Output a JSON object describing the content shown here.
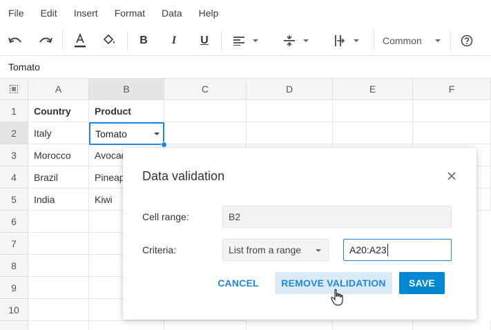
{
  "menu": [
    "File",
    "Edit",
    "Insert",
    "Format",
    "Data",
    "Help"
  ],
  "toolbar": {
    "undo_icon": "undo-icon",
    "redo_icon": "redo-icon",
    "text_color_icon": "text-color-icon",
    "fill_color_icon": "fill-color-icon",
    "bold_icon": "bold-icon",
    "italic_icon": "italic-icon",
    "underline_icon": "underline-icon",
    "align_icon": "align-left-icon",
    "valign_icon": "vertical-align-icon",
    "wrap_icon": "text-wrap-icon",
    "number_format": "Common",
    "help_icon": "help-icon"
  },
  "formula_bar": {
    "value": "Tomato"
  },
  "columns": [
    "A",
    "B",
    "C",
    "D",
    "E",
    "F"
  ],
  "rows": [
    "1",
    "2",
    "3",
    "4",
    "5",
    "6",
    "7",
    "8",
    "9",
    "10"
  ],
  "cells": {
    "A1": "Country",
    "B1": "Product",
    "A2": "Italy",
    "B2": "Tomato",
    "A3": "Morocco",
    "B3": "Avocado",
    "A4": "Brazil",
    "B4": "Pineapple",
    "A5": "India",
    "B5": "Kiwi"
  },
  "dialog": {
    "title": "Data validation",
    "cell_range_label": "Cell range:",
    "cell_range_value": "B2",
    "criteria_label": "Criteria:",
    "criteria_value": "List from a range",
    "range_value": "A20:A23",
    "cancel": "CANCEL",
    "remove": "REMOVE VALIDATION",
    "save": "SAVE"
  },
  "colors": {
    "accent": "#1e88e5",
    "save_button": "#0288d1",
    "remove_button_bg": "#dbeaf7",
    "header_bg": "#f5f5f5"
  }
}
